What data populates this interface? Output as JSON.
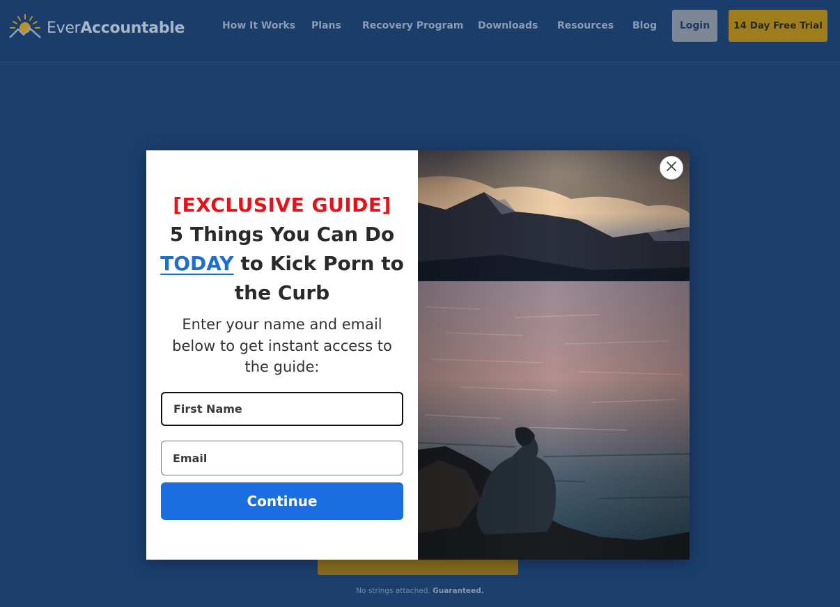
{
  "header": {
    "brand_light": "Ever",
    "brand_bold": "Accountable",
    "nav": [
      {
        "label": "How It Works"
      },
      {
        "label": "Plans"
      },
      {
        "label": "Recovery Program"
      },
      {
        "label": "Downloads"
      },
      {
        "label": "Resources"
      },
      {
        "label": "Blog"
      }
    ],
    "login_label": "Login",
    "trial_label": "14 Day Free Trial"
  },
  "background": {
    "note_text": "No strings attached.",
    "note_bold": "Guaranteed."
  },
  "modal": {
    "tag": "[EXCLUSIVE GUIDE]",
    "headline_part1": "5 Things You Can Do",
    "headline_highlight": "TODAY",
    "headline_part2": "to Kick Porn to the Curb",
    "subtext": "Enter your name and email below to get instant access to the guide:",
    "first_name_placeholder": "First Name",
    "email_placeholder": "Email",
    "continue_label": "Continue",
    "photo_icon": "lake-photo-icon",
    "close_icon": "close-icon"
  },
  "colors": {
    "page_bg": "#1c3f6e",
    "accent_red": "#e8111a",
    "accent_blue": "#1a6ee1",
    "trial_gold": "#9f7c1c"
  }
}
